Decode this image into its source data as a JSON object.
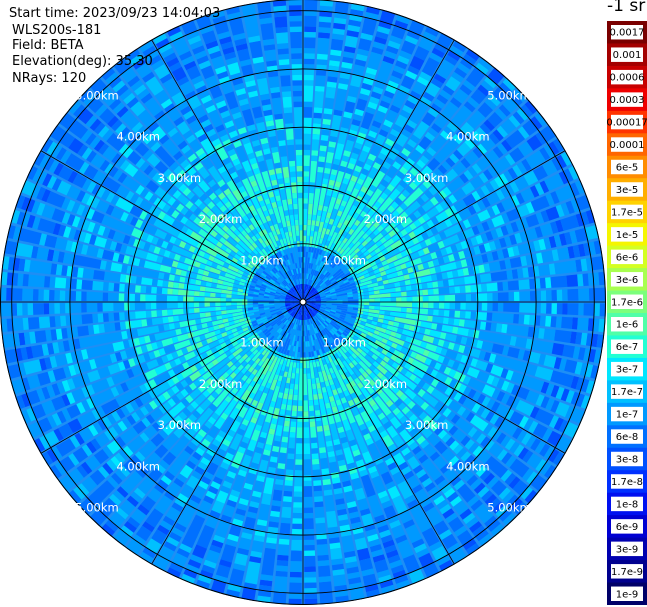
{
  "info": {
    "start_time": "Start time: 2023/09/23 14:04:03",
    "device": "WLS200s-181",
    "field": "Field: BETA",
    "elevation": "Elevation(deg): 35.30",
    "nrays": "NRays: 120"
  },
  "chart_data": {
    "type": "heatmap",
    "projection": "polar",
    "range_rings_km": [
      1,
      2,
      3,
      4,
      5
    ],
    "ring_labels": [
      "1.00km",
      "2.00km",
      "3.00km",
      "4.00km",
      "5.00km"
    ],
    "max_range_km": 5.2,
    "spokes": 12,
    "rays": 120,
    "colorbar": {
      "unit": "-1 sr",
      "labels": [
        "0.0017",
        "0.001",
        "0.0006",
        "0.0003",
        "0.00017",
        "0.0001",
        "6e-5",
        "3e-5",
        "1.7e-5",
        "1e-5",
        "6e-6",
        "3e-6",
        "1.7e-6",
        "1e-6",
        "6e-7",
        "3e-7",
        "1.7e-7",
        "1e-7",
        "6e-8",
        "3e-8",
        "1.7e-8",
        "1e-8",
        "6e-9",
        "3e-9",
        "1.7e-9",
        "1e-9"
      ],
      "colors": [
        "#7a0000",
        "#a40000",
        "#c80000",
        "#ee0000",
        "#ff3300",
        "#ff6600",
        "#ff8c00",
        "#ffae00",
        "#ffd200",
        "#f5f500",
        "#d4ff22",
        "#a8ff50",
        "#7cff7c",
        "#50ffa8",
        "#22ffd4",
        "#00e6ff",
        "#00c0ff",
        "#0099ff",
        "#0070ff",
        "#0050ff",
        "#0030ff",
        "#0010f0",
        "#0000d2",
        "#0000b0",
        "#00008e",
        "#000068"
      ]
    }
  }
}
